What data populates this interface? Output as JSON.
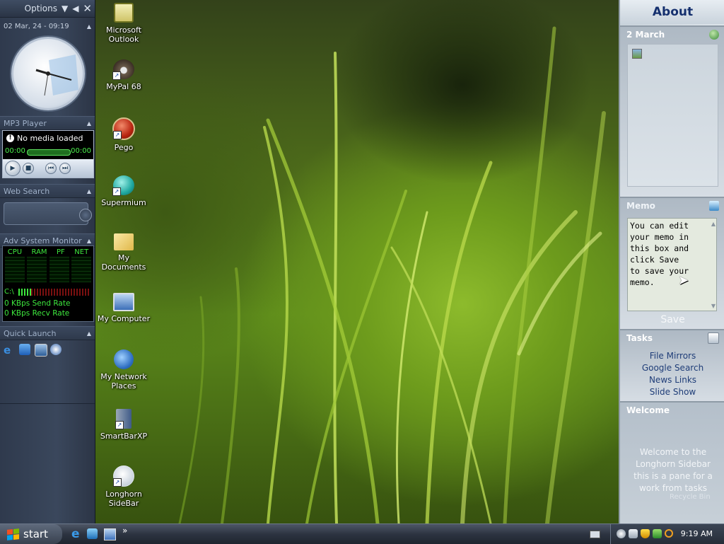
{
  "left_sidebar": {
    "options_label": "Options",
    "datetime": "02 Mar, 24 - 09:19",
    "mp3_title": "MP3 Player",
    "mp3_status": "No media loaded",
    "mp3_time_start": "00:00",
    "mp3_time_end": "00:00",
    "web_search_title": "Web Search",
    "monitor_title": "Adv System Monitor",
    "monitor_cols": [
      "CPU",
      "RAM",
      "PF",
      "NET"
    ],
    "drive_label": "C:\\",
    "send_rate": "0 KBps Send Rate",
    "recv_rate": "0 KBps Recv Rate",
    "quick_launch_title": "Quick Launch"
  },
  "desktop_icons": [
    {
      "label": "Microsoft Outlook"
    },
    {
      "label": "MyPal 68"
    },
    {
      "label": "Pego"
    },
    {
      "label": "Supermium"
    },
    {
      "label": "My Documents"
    },
    {
      "label": "My Computer"
    },
    {
      "label": "My Network Places"
    },
    {
      "label": "SmartBarXP"
    },
    {
      "label": "Longhorn SideBar"
    }
  ],
  "right_sidebar": {
    "about_title": "About",
    "date_panel_title": "2 March",
    "memo_title": "Memo",
    "memo_text": "You can edit\nyour memo in\nthis box and\nclick Save\nto save your\nmemo.",
    "save_label": "Save",
    "tasks_title": "Tasks",
    "tasks": [
      "File Mirrors",
      "Google Search",
      "News Links",
      "Slide Show"
    ],
    "welcome_title": "Welcome",
    "welcome_text": "Welcome to the Longhorn Sidebar this is a pane for a work from tasks",
    "recycle_label": "Recycle Bin"
  },
  "taskbar": {
    "start_label": "start",
    "overflow": "»",
    "clock": "9:19 AM"
  },
  "colors": {
    "accent_dark": "#15306e",
    "monitor_green": "#3ee83e"
  }
}
